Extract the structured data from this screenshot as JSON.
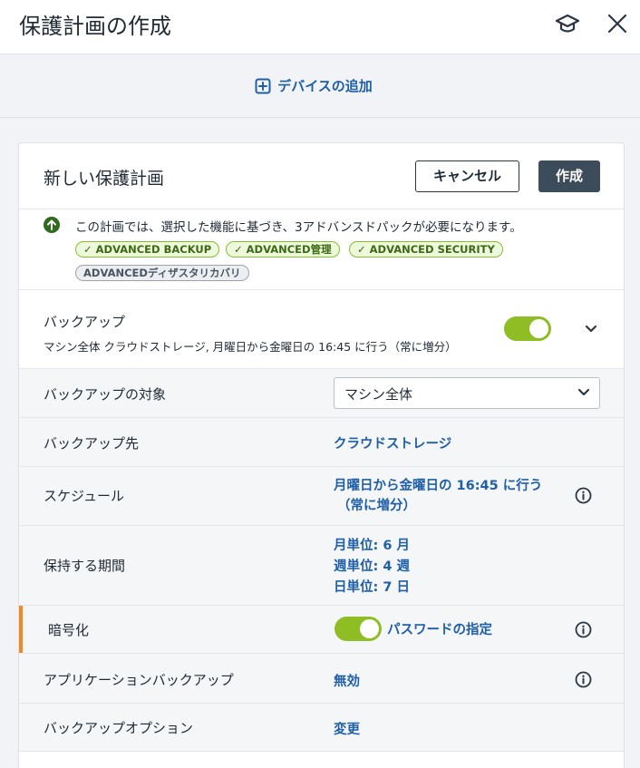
{
  "header": {
    "title": "保護計画の作成",
    "hat_icon": "graduation-cap-icon",
    "close_icon": "close-icon"
  },
  "add_device": {
    "icon": "plus-square-icon",
    "label": "デバイスの追加"
  },
  "plan": {
    "name": "新しい保護計画",
    "cancel_label": "キャンセル",
    "create_label": "作成"
  },
  "notice": {
    "icon": "arrow-up-circle-icon",
    "message": "この計画では、選択した機能に基づき、3アドバンスドパックが必要になります。",
    "badges": [
      {
        "label": "ADVANCED BACKUP",
        "checked": true
      },
      {
        "label": "ADVANCED管理",
        "checked": true
      },
      {
        "label": "ADVANCED SECURITY",
        "checked": true
      },
      {
        "label": "ADVANCEDディザスタリカバリ",
        "checked": false
      }
    ]
  },
  "backup": {
    "label": "バックアップ",
    "summary": "マシン全体 クラウドストレージ, 月曜日から金曜日の 16:45 に行う（常に増分）",
    "enabled": true
  },
  "rows": {
    "target": {
      "label": "バックアップの対象",
      "value": "マシン全体"
    },
    "destination": {
      "label": "バックアップ先",
      "value": "クラウドストレージ"
    },
    "schedule": {
      "label": "スケジュール",
      "value_line1": "月曜日から金曜日の 16:45 に行う",
      "value_line2": "（常に増分）"
    },
    "retention": {
      "label": "保持する期間",
      "monthly": "月単位: 6 月",
      "weekly": "週単位: 4 週",
      "daily": "日単位: 7 日"
    },
    "encryption": {
      "label": "暗号化",
      "value": "パスワードの指定",
      "enabled": true
    },
    "app_backup": {
      "label": "アプリケーションバックアップ",
      "value": "無効"
    },
    "options": {
      "label": "バックアップオプション",
      "value": "変更"
    }
  },
  "colors": {
    "link": "#1f5fa8",
    "toggle_on": "#8fbd24",
    "accent": "#f08a24",
    "primary_button": "#3d4c5b",
    "badge_green": "#86bc33"
  }
}
